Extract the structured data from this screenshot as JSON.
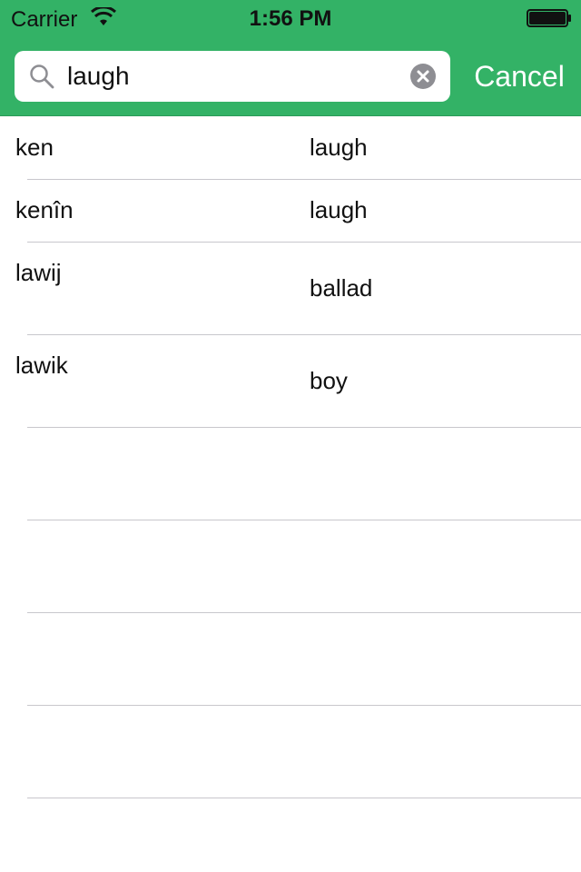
{
  "status_bar": {
    "carrier": "Carrier",
    "time": "1:56 PM"
  },
  "search": {
    "value": "laugh",
    "cancel_label": "Cancel"
  },
  "results": [
    {
      "term": "ken",
      "meaning": "laugh"
    },
    {
      "term": "kenîn",
      "meaning": "laugh"
    },
    {
      "term": "lawij",
      "meaning": "ballad"
    },
    {
      "term": "lawik",
      "meaning": "boy"
    }
  ],
  "colors": {
    "header_bg": "#33b266",
    "separator": "#c8c7cc"
  }
}
